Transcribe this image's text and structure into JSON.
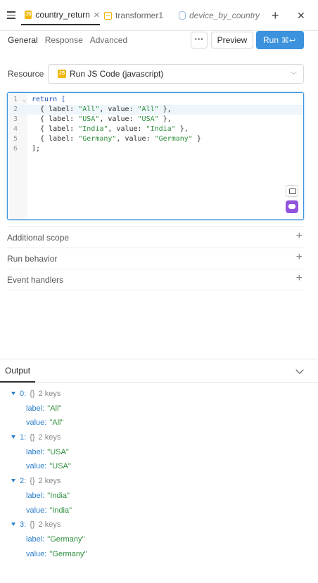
{
  "tabs": [
    {
      "label": "country_return",
      "active": true
    },
    {
      "label": "transformer1",
      "active": false
    },
    {
      "label": "device_by_country",
      "active": false
    }
  ],
  "subnav": [
    "General",
    "Response",
    "Advanced"
  ],
  "actions": {
    "more": "···",
    "preview": "Preview",
    "run": "Run",
    "run_shortcut": "⌘↩"
  },
  "resource": {
    "label": "Resource",
    "value": "Run JS Code (javascript)",
    "badge": "JS"
  },
  "editor": {
    "lines": [
      {
        "n": "1",
        "text": "return ["
      },
      {
        "n": "2",
        "text": "  { label: \"All\", value: \"All\" },"
      },
      {
        "n": "3",
        "text": "  { label: \"USA\", value: \"USA\" },"
      },
      {
        "n": "4",
        "text": "  { label: \"India\", value: \"India\" },"
      },
      {
        "n": "5",
        "text": "  { label: \"Germany\", value: \"Germany\" }"
      },
      {
        "n": "6",
        "text": "];"
      }
    ],
    "active_line": 2
  },
  "sections": [
    "Additional scope",
    "Run behavior",
    "Event handlers"
  ],
  "output": {
    "tab": "Output",
    "brace": "{}",
    "items": [
      {
        "index": "0:",
        "keys": "2 keys",
        "label_key": "label:",
        "label": "\"All\"",
        "value_key": "value:",
        "value": "\"All\""
      },
      {
        "index": "1:",
        "keys": "2 keys",
        "label_key": "label:",
        "label": "\"USA\"",
        "value_key": "value:",
        "value": "\"USA\""
      },
      {
        "index": "2:",
        "keys": "2 keys",
        "label_key": "label:",
        "label": "\"India\"",
        "value_key": "value:",
        "value": "\"India\""
      },
      {
        "index": "3:",
        "keys": "2 keys",
        "label_key": "label:",
        "label": "\"Germany\"",
        "value_key": "value:",
        "value": "\"Germany\""
      }
    ]
  },
  "colors": {
    "accent": "#3c92dc",
    "js_badge": "#f2b705",
    "string": "#2f8f3c",
    "key": "#2b7fc9"
  }
}
